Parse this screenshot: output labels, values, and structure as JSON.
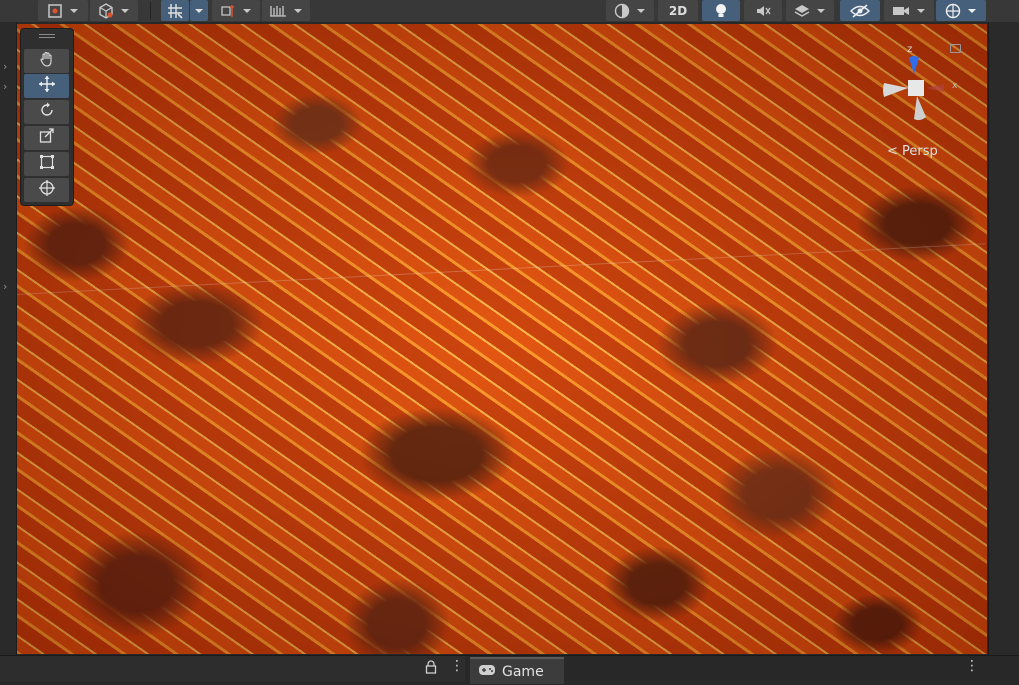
{
  "toolbar": {
    "mode_2d_label": "2D",
    "buttons": [
      {
        "name": "pivot-icon"
      },
      {
        "name": "global-icon"
      },
      {
        "name": "grid-snap-icon"
      },
      {
        "name": "increment-snap-icon"
      },
      {
        "name": "draw-mode-icon"
      },
      {
        "name": "lighting-icon"
      },
      {
        "name": "audio-mute-icon"
      },
      {
        "name": "effects-icon"
      },
      {
        "name": "visibility-icon"
      },
      {
        "name": "camera-icon"
      },
      {
        "name": "gizmos-icon"
      }
    ]
  },
  "scene": {
    "projection_label": "< Persp",
    "axis_z_label": "z",
    "active_tool": "move"
  },
  "tools": [
    "hand",
    "move",
    "rotate",
    "scale",
    "rect",
    "transform"
  ],
  "bottom": {
    "game_tab_label": "Game"
  },
  "colors": {
    "toolbar_bg": "#383838",
    "active_button": "#46607c",
    "lava_glow": "#ff9a2a",
    "lava_dark": "#5e200c",
    "panel_bg": "#282828"
  }
}
